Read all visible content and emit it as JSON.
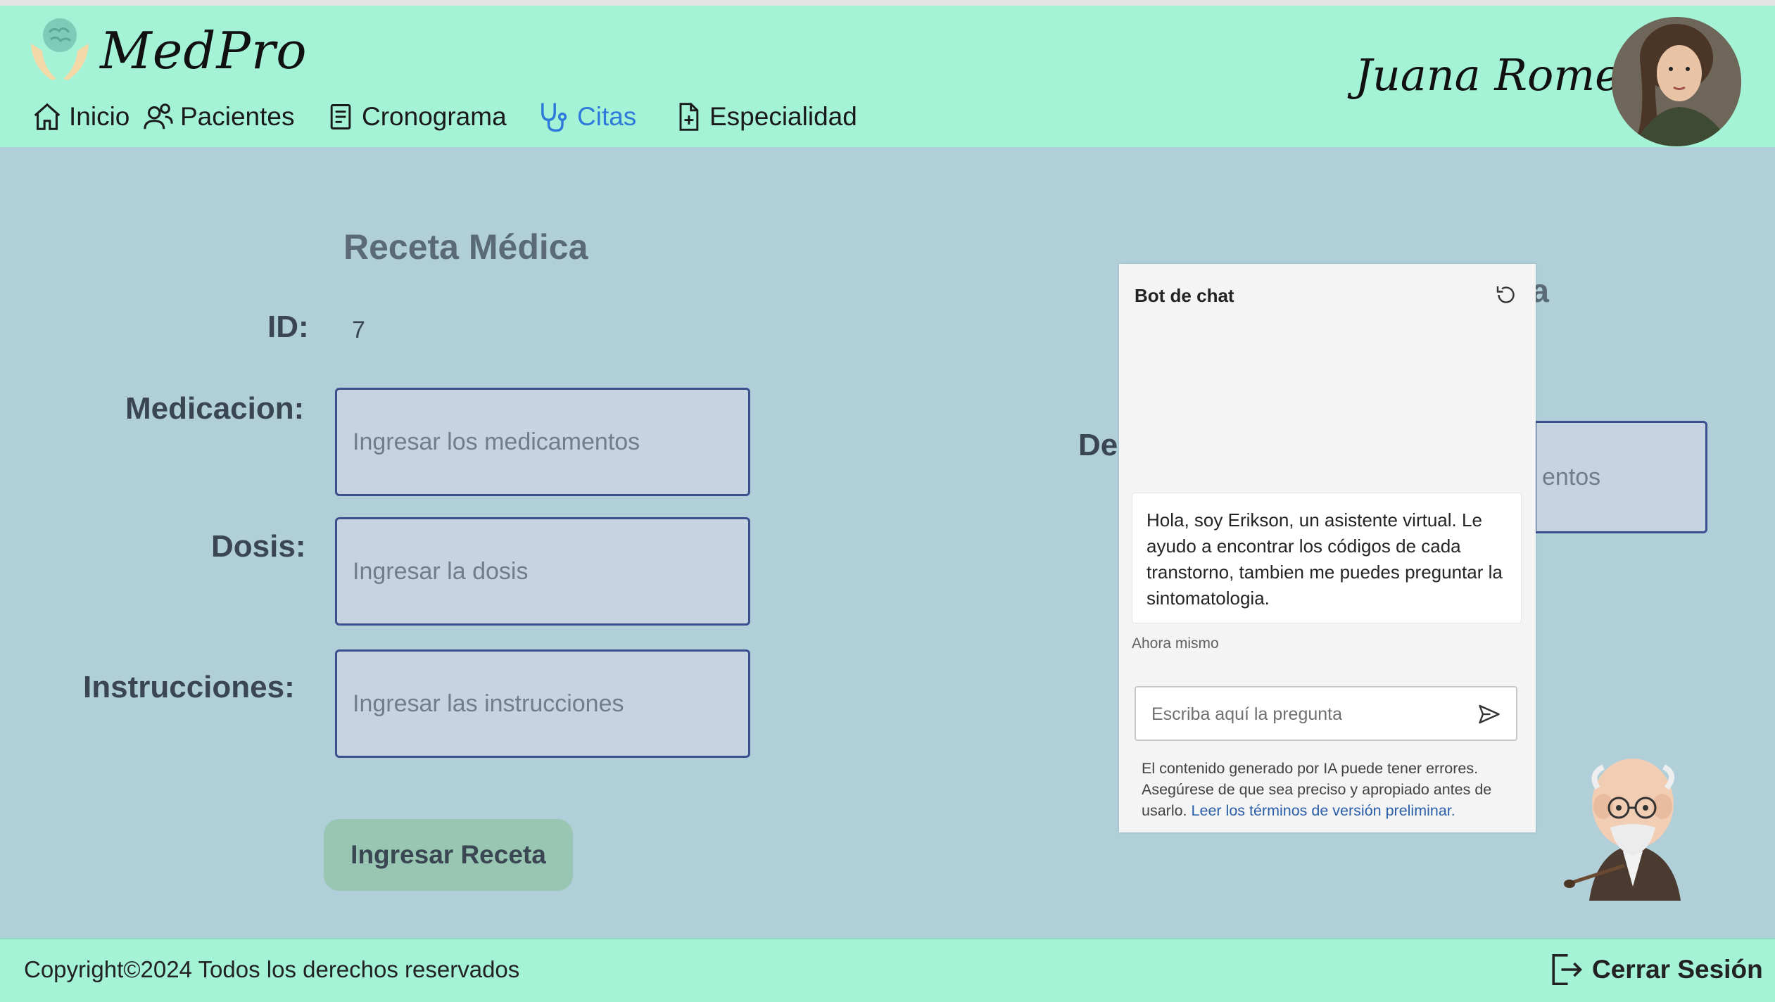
{
  "app": {
    "brand": "MedPro",
    "user_name": "Juana Romero"
  },
  "nav": [
    {
      "label": "Inicio",
      "icon": "home-icon"
    },
    {
      "label": "Pacientes",
      "icon": "users-icon"
    },
    {
      "label": "Cronograma",
      "icon": "document-list-icon"
    },
    {
      "label": "Citas",
      "icon": "stethoscope-icon",
      "active": true
    },
    {
      "label": "Especialidad",
      "icon": "file-plus-icon"
    }
  ],
  "form": {
    "title": "Receta Médica",
    "id_label": "ID:",
    "id_value": "7",
    "medicacion_label": "Medicacion:",
    "medicacion_placeholder": "Ingresar los medicamentos",
    "dosis_label": "Dosis:",
    "dosis_placeholder": "Ingresar la dosis",
    "instrucciones_label": "Instrucciones:",
    "instrucciones_placeholder": "Ingresar las instrucciones",
    "submit_label": "Ingresar Receta"
  },
  "background_form": {
    "title_fragment": "ta",
    "label_fragment": "De",
    "field_fragment": "entos"
  },
  "chat": {
    "title": "Bot de chat",
    "message": "Hola, soy Erikson, un asistente virtual. Le ayudo a encontrar los códigos de cada transtorno, tambien me puedes preguntar la sintomatologia.",
    "time": "Ahora mismo",
    "input_placeholder": "Escriba aquí la pregunta",
    "disclaimer": "El contenido generado por IA puede tener errores. Asegúrese de que sea preciso y apropiado antes de usarlo.",
    "disclaimer_link": "Leer los términos de versión preliminar."
  },
  "footer": {
    "copyright": "Copyright©2024 Todos los derechos reservados",
    "logout_label": "Cerrar Sesión"
  },
  "colors": {
    "header_bg": "#a5f3d6",
    "page_bg": "#b0cfd8",
    "field_bg": "#c6d3e0",
    "field_border": "#3c5090",
    "button_bg": "#98c6b3",
    "active_nav": "#2e79d9"
  }
}
